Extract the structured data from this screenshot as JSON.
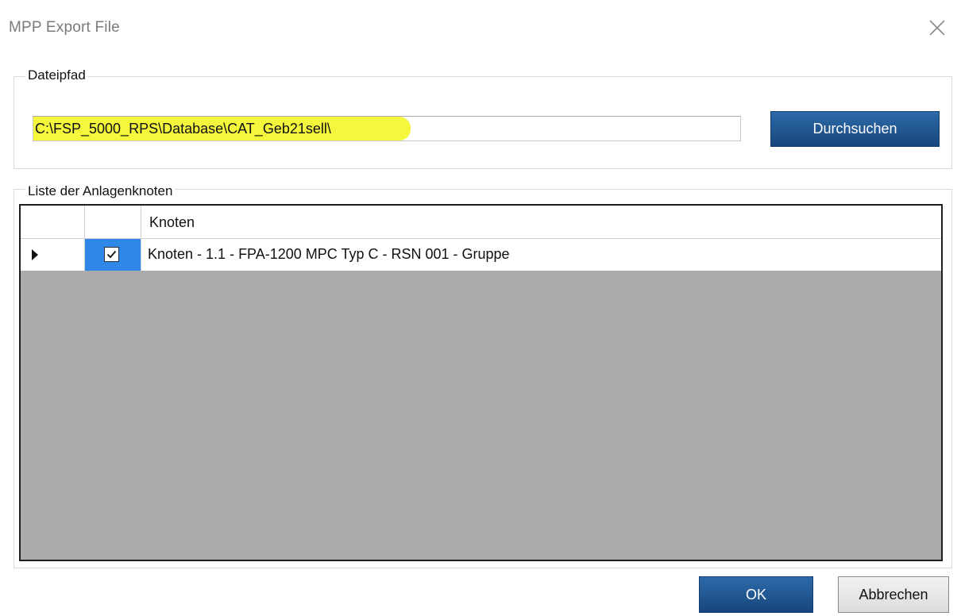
{
  "window": {
    "title": "MPP Export File",
    "close_icon": "close-icon"
  },
  "file_path_group": {
    "label": "Dateipfad",
    "path_value": "C:\\FSP_5000_RPS\\Database\\CAT_Geb21sell\\",
    "highlight_color": "#f4f73c",
    "browse_button": "Durchsuchen"
  },
  "nodes_group": {
    "label": "Liste der Anlagenknoten",
    "columns": [
      "",
      "",
      "Knoten"
    ],
    "rows": [
      {
        "row_indicator_icon": "row-pointer-icon",
        "checked": true,
        "name": "Knoten - 1.1 - FPA-1200 MPC Typ C - RSN 001 - Gruppe"
      }
    ],
    "selection_color": "#2f87e8"
  },
  "footer": {
    "ok_button": "OK",
    "cancel_button": "Abbrechen"
  },
  "colors": {
    "accent_button": "#1f5690",
    "grid_background": "#ababab"
  }
}
